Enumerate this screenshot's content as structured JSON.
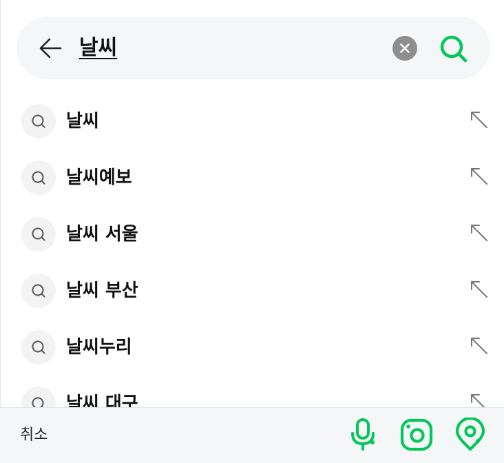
{
  "search": {
    "query": "날씨"
  },
  "suggestions": [
    {
      "label": "날씨"
    },
    {
      "label": "날씨예보"
    },
    {
      "label": "날씨 서울"
    },
    {
      "label": "날씨 부산"
    },
    {
      "label": "날씨누리"
    },
    {
      "label": "날씨 대구"
    }
  ],
  "bottom_bar": {
    "cancel_label": "취소"
  },
  "icons": {
    "back": "arrow-left-icon",
    "clear": "close-circle-icon",
    "search": "search-icon",
    "suggestion": "search-icon",
    "fill": "arrow-up-left-icon",
    "voice": "microphone-icon",
    "lens": "camera-lens-icon",
    "location": "location-pin-icon"
  },
  "colors": {
    "accent": "#03c75a",
    "search_bar_bg": "#f5f6f8",
    "clear_bg": "#8e8e8e"
  }
}
